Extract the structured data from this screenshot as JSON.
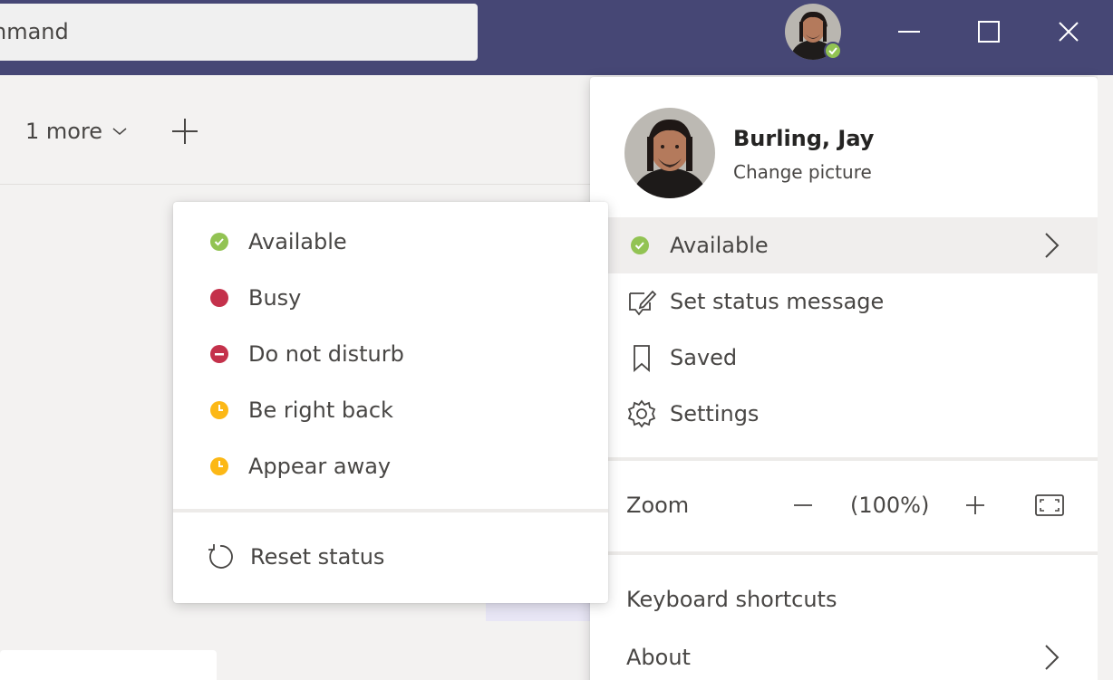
{
  "titlebar": {
    "search_text": "nmand",
    "background_color": "#464775"
  },
  "tabs": {
    "more_label": "1 more"
  },
  "status_menu": {
    "items": [
      {
        "label": "Available",
        "color": "#92c353",
        "icon": "available-check-icon"
      },
      {
        "label": "Busy",
        "color": "#c4314b",
        "icon": "busy-dot-icon"
      },
      {
        "label": "Do not disturb",
        "color": "#c4314b",
        "icon": "do-not-disturb-icon"
      },
      {
        "label": "Be right back",
        "color": "#fcb816",
        "icon": "clock-icon"
      },
      {
        "label": "Appear away",
        "color": "#fcb816",
        "icon": "clock-icon"
      }
    ],
    "reset_label": "Reset status"
  },
  "profile": {
    "name": "Burling, Jay",
    "change_picture": "Change picture",
    "status_label": "Available",
    "set_status_message": "Set status message",
    "saved": "Saved",
    "settings": "Settings",
    "zoom_label": "Zoom",
    "zoom_out": "−",
    "zoom_value": "(100%)",
    "zoom_in": "+",
    "keyboard_shortcuts": "Keyboard shortcuts",
    "about": "About"
  }
}
